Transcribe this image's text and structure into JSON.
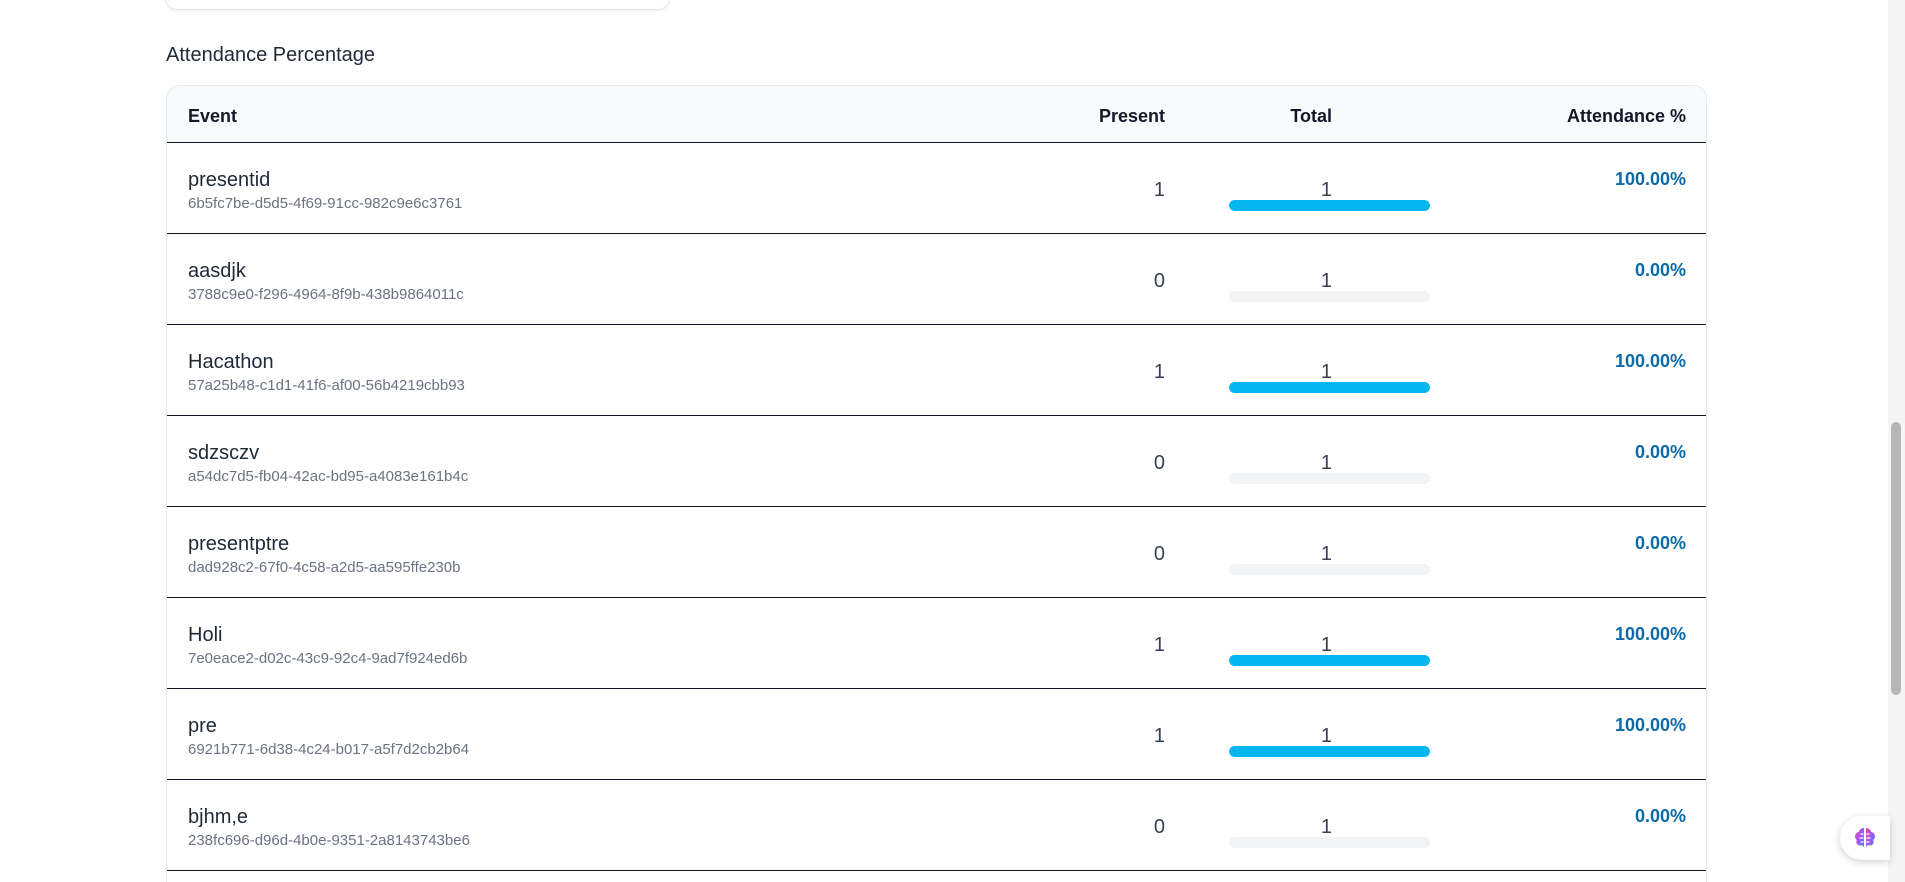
{
  "section": {
    "title": "Attendance Percentage"
  },
  "table": {
    "headers": {
      "event": "Event",
      "present": "Present",
      "total": "Total",
      "attendance": "Attendance %"
    },
    "rows": [
      {
        "name": "presentid",
        "id": "6b5fc7be-d5d5-4f69-91cc-982c9e6c3761",
        "present": "1",
        "total": "1",
        "percent": "100.00%",
        "fill": 1.0
      },
      {
        "name": "aasdjk",
        "id": "3788c9e0-f296-4964-8f9b-438b9864011c",
        "present": "0",
        "total": "1",
        "percent": "0.00%",
        "fill": 0.0
      },
      {
        "name": "Hacathon",
        "id": "57a25b48-c1d1-41f6-af00-56b4219cbb93",
        "present": "1",
        "total": "1",
        "percent": "100.00%",
        "fill": 1.0
      },
      {
        "name": "sdzsczv",
        "id": "a54dc7d5-fb04-42ac-bd95-a4083e161b4c",
        "present": "0",
        "total": "1",
        "percent": "0.00%",
        "fill": 0.0
      },
      {
        "name": "presentptre",
        "id": "dad928c2-67f0-4c58-a2d5-aa595ffe230b",
        "present": "0",
        "total": "1",
        "percent": "0.00%",
        "fill": 0.0
      },
      {
        "name": "Holi",
        "id": "7e0eace2-d02c-43c9-92c4-9ad7f924ed6b",
        "present": "1",
        "total": "1",
        "percent": "100.00%",
        "fill": 1.0
      },
      {
        "name": "pre",
        "id": "6921b771-6d38-4c24-b017-a5f7d2cb2b64",
        "present": "1",
        "total": "1",
        "percent": "100.00%",
        "fill": 1.0
      },
      {
        "name": "bjhm,e",
        "id": "238fc696-d96d-4b0e-9351-2a8143743be6",
        "present": "0",
        "total": "1",
        "percent": "0.00%",
        "fill": 0.0
      }
    ]
  },
  "colors": {
    "bar": "#06b6f1",
    "track": "#f1f3f5",
    "percent": "#0b6aa8"
  },
  "assistant": {
    "icon": "brain-icon"
  }
}
